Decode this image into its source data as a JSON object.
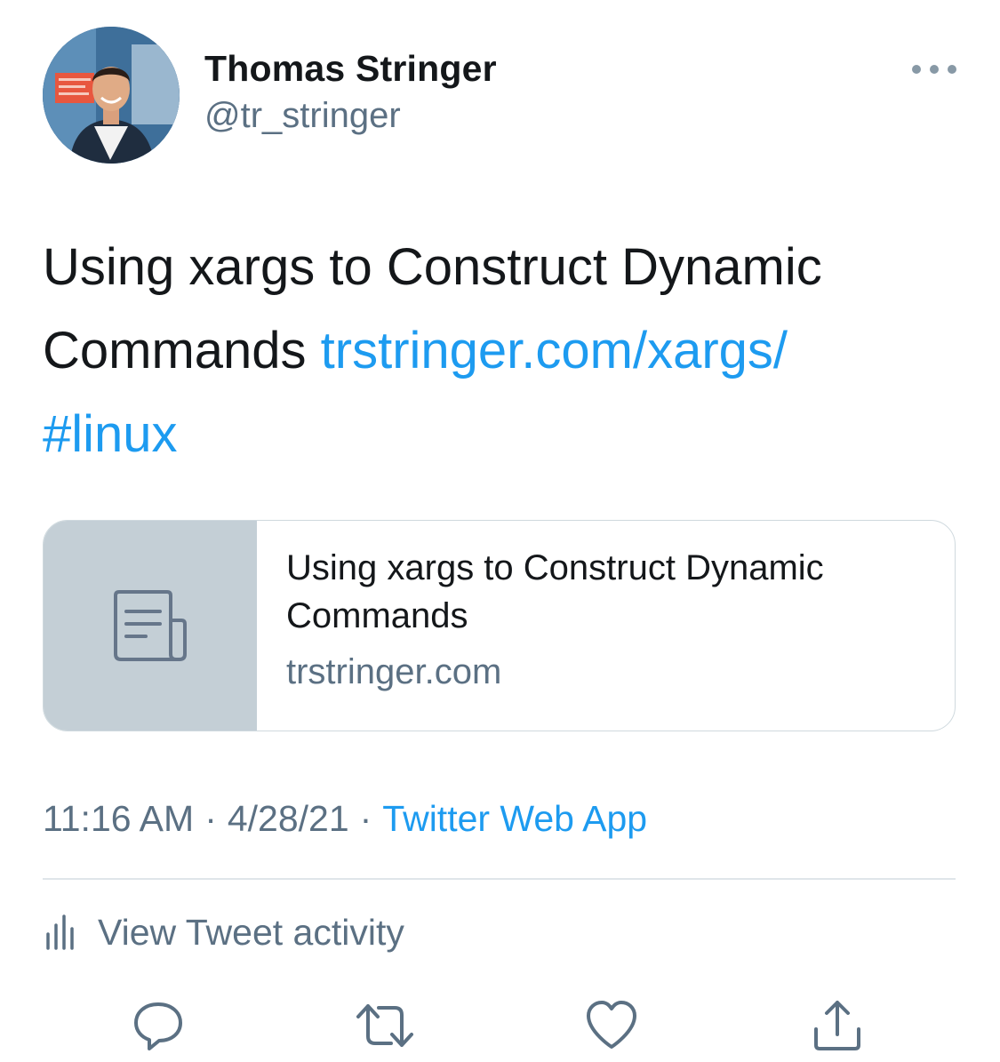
{
  "author": {
    "name": "Thomas Stringer",
    "handle": "@tr_stringer"
  },
  "tweet": {
    "text": "Using xargs to Construct Dynamic Commands",
    "link": "trstringer.com/xargs/",
    "hashtag": "#linux"
  },
  "card": {
    "title": "Using xargs to Construct Dynamic Commands",
    "domain": "trstringer.com",
    "icon": "document-icon"
  },
  "meta": {
    "time": "11:16 AM",
    "date": "4/28/21",
    "source": "Twitter Web App",
    "separator": "·"
  },
  "activity": {
    "label": "View Tweet activity",
    "icon": "bar-chart-icon"
  },
  "actions": {
    "reply": "reply-icon",
    "retweet": "retweet-icon",
    "like": "heart-icon",
    "share": "share-icon"
  },
  "colors": {
    "link": "#1d9bf0",
    "secondary_text": "#5b7083",
    "card_thumb": "#c4cfd6"
  }
}
